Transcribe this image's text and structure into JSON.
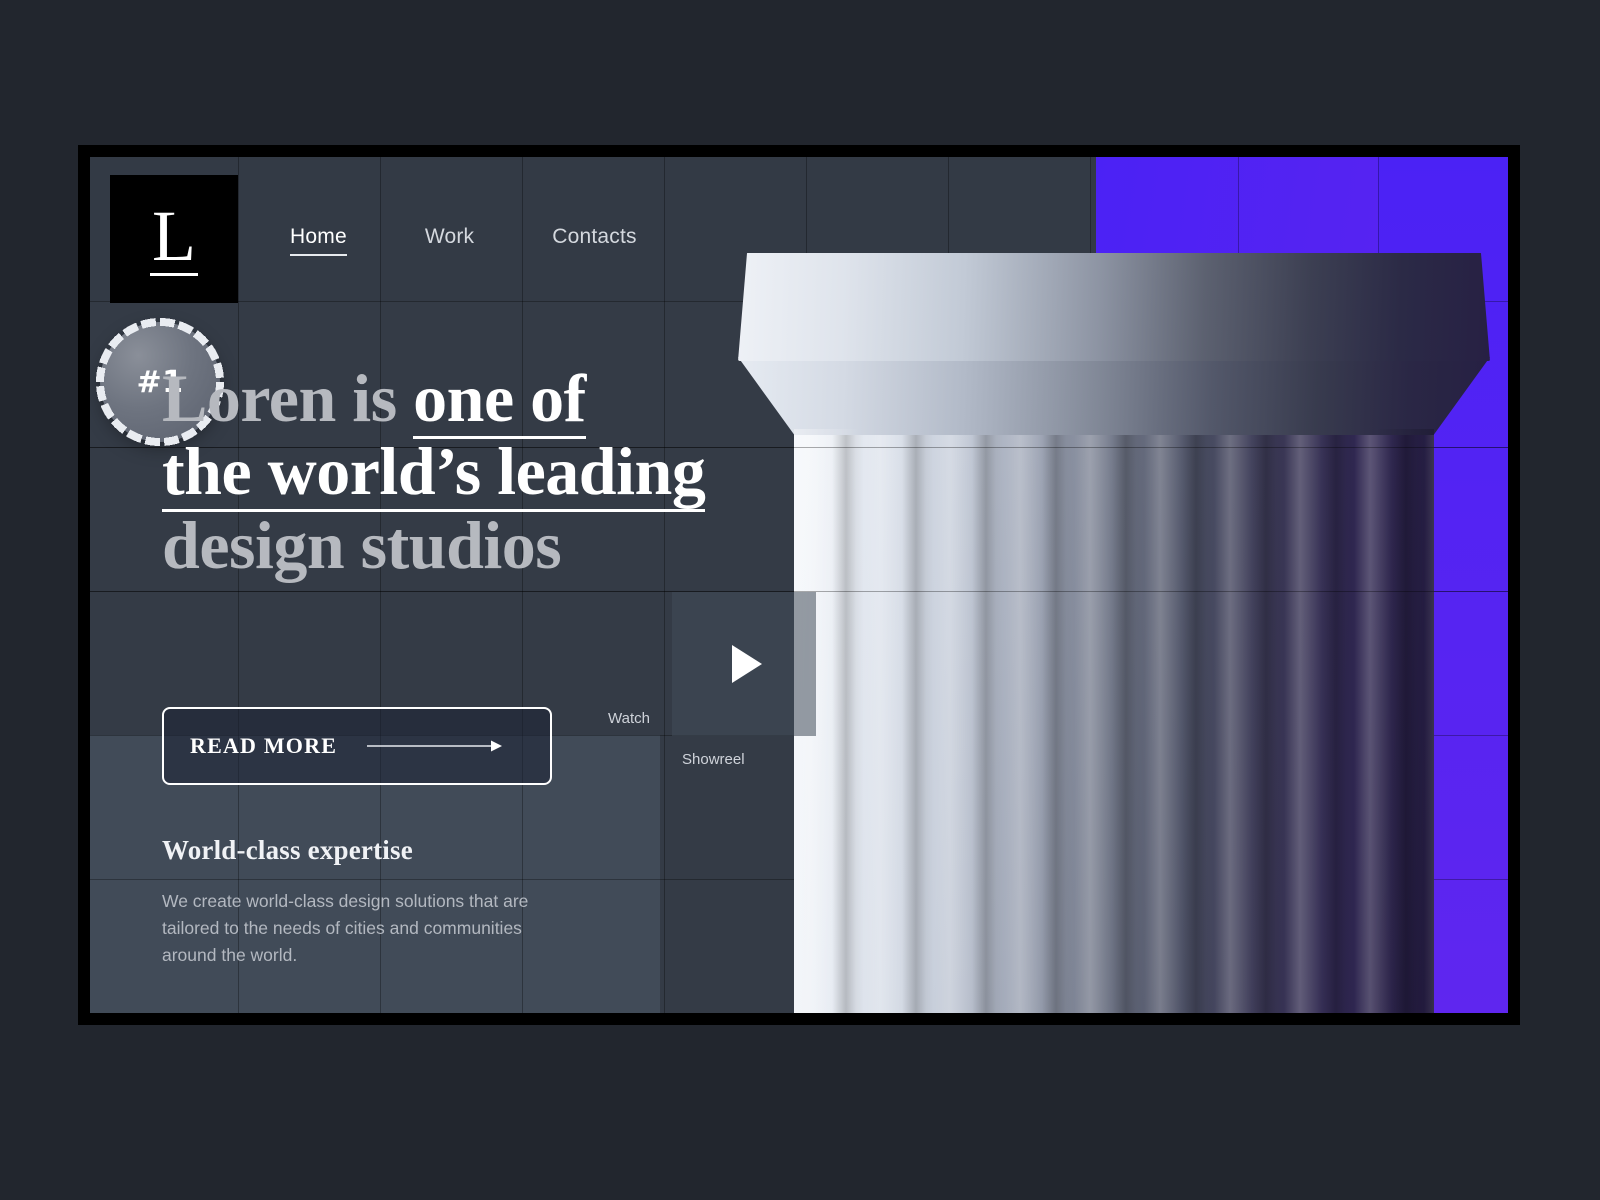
{
  "brand": {
    "logo_letter": "L"
  },
  "nav": {
    "items": [
      {
        "label": "Home",
        "active": true
      },
      {
        "label": "Work",
        "active": false
      },
      {
        "label": "Contacts",
        "active": false
      }
    ]
  },
  "hero": {
    "headline_part1": "Loren is ",
    "headline_emph1": "one of",
    "headline_emph2": "the world’s leading",
    "headline_part2": "design studios",
    "badge": "#1",
    "cta": {
      "label": "READ MORE",
      "icon": "arrow-right-icon"
    },
    "showreel": {
      "watch": "Watch",
      "showreel": "Showreel",
      "icon": "play-icon"
    }
  },
  "expertise": {
    "title": "World-class expertise",
    "body": "We create world-class design solutions that are tailored to the needs of cities and communities around the world."
  },
  "colors": {
    "page_background": "#22262e",
    "screen_background": "#343b46",
    "panel_light": "#414b58",
    "accent_purple": "#4b22f5",
    "accent_purple_deep": "#5f26ef",
    "text_primary": "#ffffff",
    "text_muted": "#b3b8c0",
    "frame": "#000000"
  }
}
